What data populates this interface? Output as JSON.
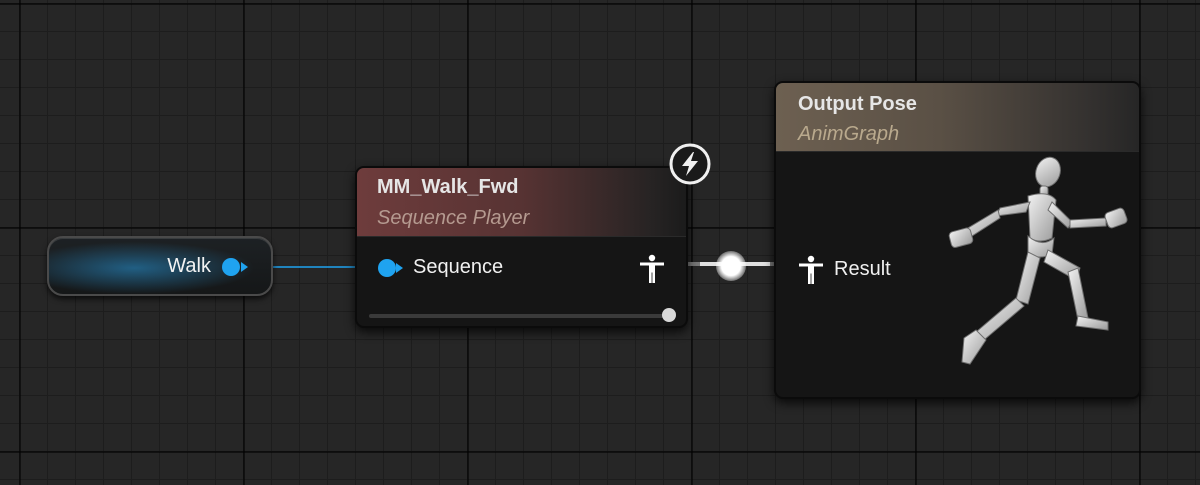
{
  "variable_node": {
    "label": "Walk",
    "pin_color": "#1fa3f0"
  },
  "sequence_player": {
    "title": "MM_Walk_Fwd",
    "subtitle": "Sequence Player",
    "input_pin": "Sequence",
    "output_pin_icon": "person-pose-icon",
    "header_color": "#6e3c3c",
    "fast_path_icon": "lightning-bolt-icon"
  },
  "output_pose": {
    "title": "Output Pose",
    "subtitle": "AnimGraph",
    "input_pin": "Result",
    "input_pin_icon": "person-pose-icon",
    "preview_icon": "running-mannequin-icon",
    "header_color": "#6d6051"
  },
  "wires": {
    "float_wire_color": "#1fa3f0",
    "pose_wire_color": "#ffffff"
  }
}
